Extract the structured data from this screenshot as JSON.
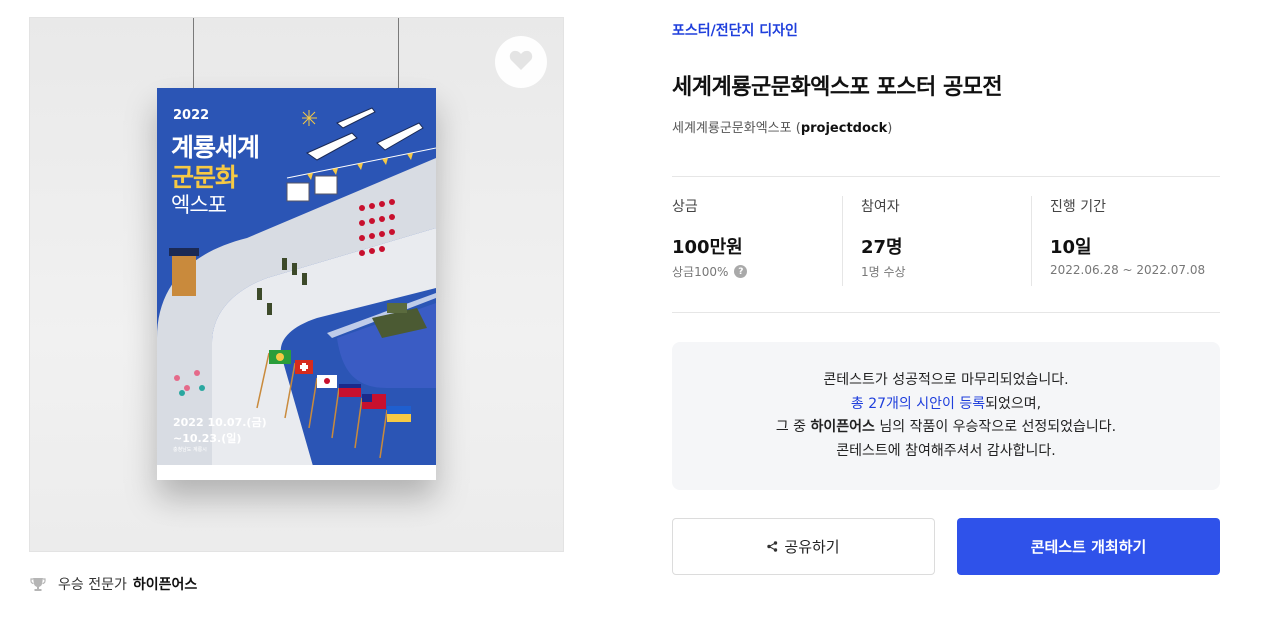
{
  "category": "포스터/전단지 디자인",
  "title": "세계계룡군문화엑스포 포스터 공모전",
  "host": {
    "name": "세계계룡군문화엑스포",
    "handle": "projectdock"
  },
  "stats": [
    {
      "label": "상금",
      "value": "100만원",
      "sub": "상금100%",
      "help_icon": "question-icon"
    },
    {
      "label": "참여자",
      "value": "27명",
      "sub": "1명 수상"
    },
    {
      "label": "진행 기간",
      "value": "10일",
      "sub": "2022.06.28 ~ 2022.07.08"
    }
  ],
  "notice": {
    "line1": "콘테스트가 성공적으로 마무리되었습니다.",
    "line2_link": "총 27개의 시안이 등록",
    "line2_rest": "되었으며,",
    "line3_pre": "그 중 ",
    "line3_bold": "하이픈어스",
    "line3_post": " 님의 작품이 우승작으로 선정되었습니다.",
    "line4": "콘테스트에 참여해주셔서 감사합니다."
  },
  "winner": {
    "label": "우승 전문가",
    "name": "하이픈어스",
    "icon": "trophy-icon"
  },
  "buttons": {
    "share": "공유하기",
    "host_contest": "콘테스트 개최하기"
  },
  "poster": {
    "year": "2022",
    "title1": "계룡세계",
    "title2": "군문화",
    "title3": "엑스포",
    "date1": "2022 10.07.(금)",
    "date2": "~10.23.(일)",
    "location": "충청남도 계룡시"
  },
  "colors": {
    "accent": "#2f52ea",
    "link": "#1f3fdc",
    "poster_bg": "#2b55b5",
    "notice_bg": "#f5f6f8"
  }
}
